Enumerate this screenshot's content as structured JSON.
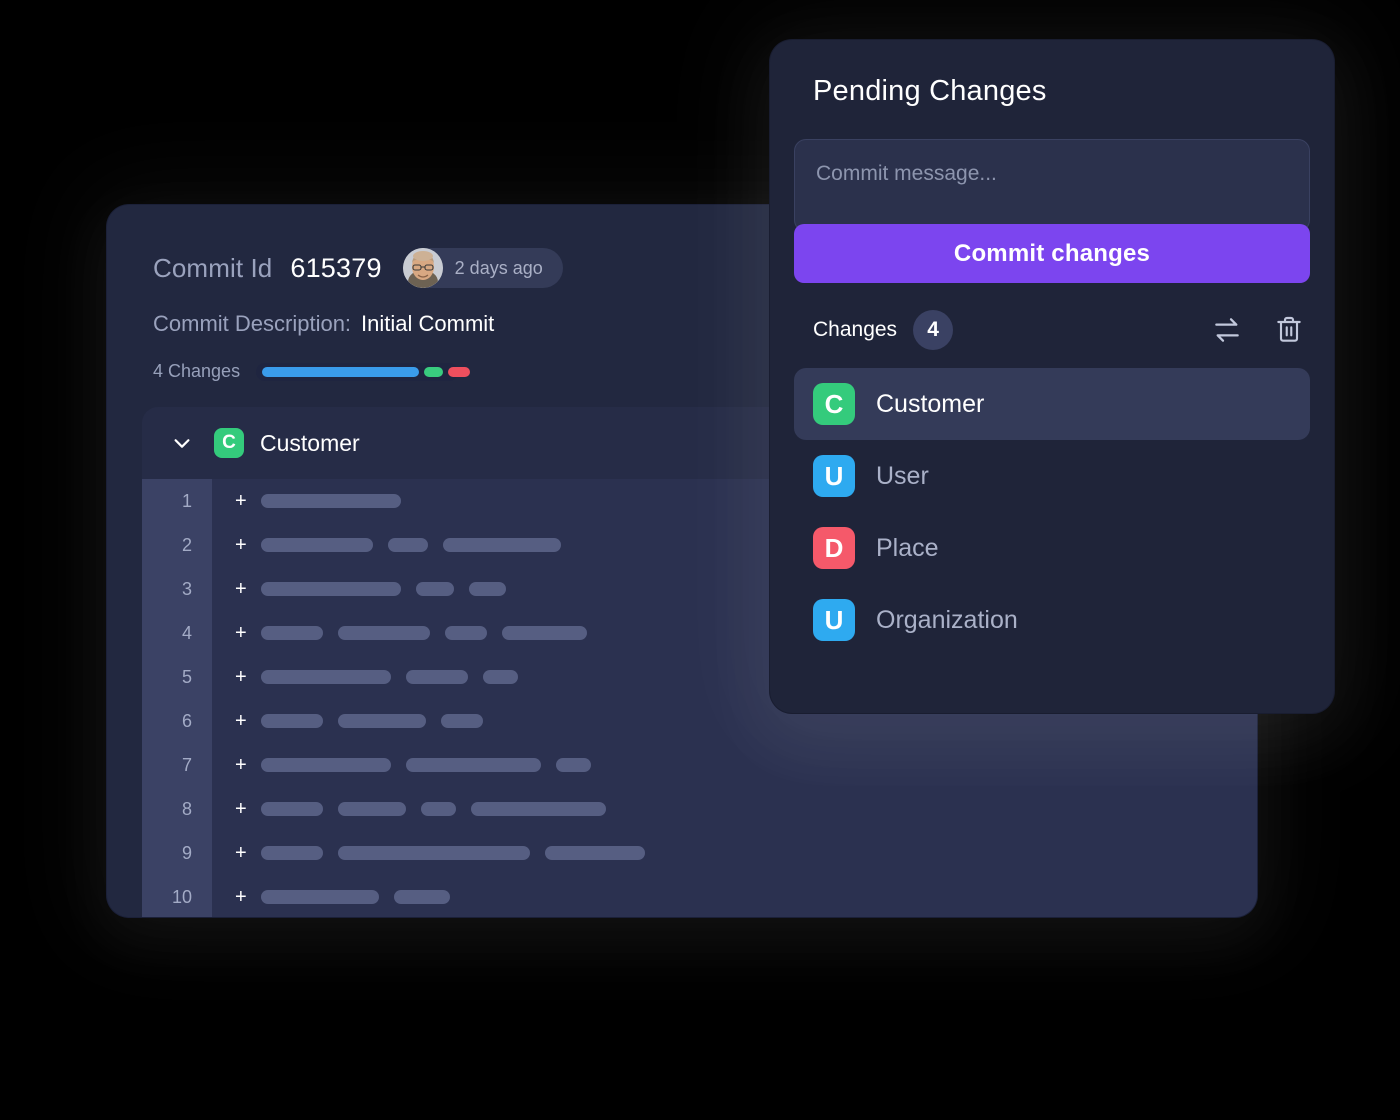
{
  "commit_card": {
    "commit_id_label": "Commit Id",
    "commit_id_value": "615379",
    "author_time": "2 days ago",
    "avatar_icon": "user-avatar-photo",
    "description_label": "Commit Description:",
    "description_value": "Initial Commit",
    "changes_summary": "4 Changes",
    "change_bar": {
      "colors": {
        "added": "#3a9ceb",
        "modified": "#39cc7f",
        "removed": "#ee4f5e"
      },
      "segments": [
        {
          "name": "added",
          "width": 157
        },
        {
          "name": "modified",
          "width": 19
        },
        {
          "name": "removed",
          "width": 22
        }
      ]
    },
    "file": {
      "expand_icon": "chevron-down-icon",
      "badge_letter": "C",
      "badge_color": "#34cb7c",
      "name": "Customer"
    },
    "diff": {
      "marker": "+",
      "line_numbers": [
        "1",
        "2",
        "3",
        "4",
        "5",
        "6",
        "7",
        "8",
        "9",
        "10"
      ],
      "line_tokens": [
        [
          140
        ],
        [
          112,
          40,
          118
        ],
        [
          140,
          38,
          37
        ],
        [
          62,
          92,
          42,
          85
        ],
        [
          130,
          62,
          35
        ],
        [
          62,
          88,
          42
        ],
        [
          130,
          135,
          35
        ],
        [
          62,
          68,
          35,
          135
        ],
        [
          62,
          192,
          100
        ],
        [
          118,
          56
        ]
      ]
    }
  },
  "pending_panel": {
    "title": "Pending Changes",
    "commit_message_placeholder": "Commit message...",
    "commit_message_value": "",
    "commit_button_label": "Commit changes",
    "commit_button_color": "#7c45ef",
    "changes_label": "Changes",
    "changes_count": "4",
    "actions": [
      {
        "icon": "swap-arrows-icon",
        "name": "swap-changes-button"
      },
      {
        "icon": "trash-icon",
        "name": "discard-changes-button"
      }
    ],
    "items": [
      {
        "letter": "C",
        "label": "Customer",
        "color": "#34cb7c",
        "color_name": "green",
        "selected": true
      },
      {
        "letter": "U",
        "label": "User",
        "color": "#2eaaf0",
        "color_name": "blue",
        "selected": false
      },
      {
        "letter": "D",
        "label": "Place",
        "color": "#f5596a",
        "color_name": "red",
        "selected": false
      },
      {
        "letter": "U",
        "label": "Organization",
        "color": "#2eaaf0",
        "color_name": "blue",
        "selected": false
      }
    ]
  }
}
